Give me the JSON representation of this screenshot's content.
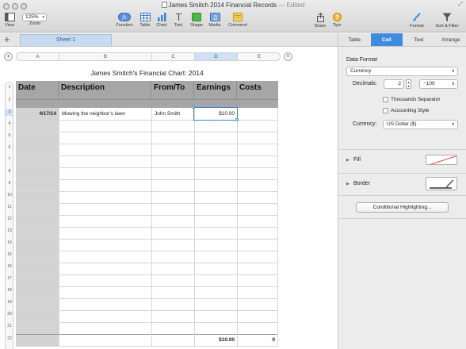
{
  "window": {
    "title": "James Smitch 2014 Financial Records",
    "status": "— Edited"
  },
  "toolbar": {
    "view": "View",
    "zoom_value": "125%",
    "zoom": "Zoom",
    "function": "Function",
    "table": "Table",
    "chart": "Chart",
    "text": "Text",
    "shape": "Shape",
    "media": "Media",
    "comment": "Comment",
    "share": "Share",
    "tips": "Tips",
    "format": "Format",
    "sort_filter": "Sort & Filter"
  },
  "sheets": {
    "add": "+",
    "active": "Sheet 1"
  },
  "columns": [
    "A",
    "B",
    "C",
    "D",
    "E"
  ],
  "table": {
    "title": "James Smitch's Financial Chart: 2014",
    "headers": [
      "Date",
      "Description",
      "From/To",
      "Earnings",
      "Costs"
    ],
    "row3": {
      "date": "4/17/14",
      "description": "Mowing the neighbor's lawn",
      "from_to": "John Smith",
      "earnings": "$10.00"
    },
    "row21": {
      "earnings": "$10.00",
      "costs": "0"
    },
    "row22": {
      "costs": "10"
    }
  },
  "row_numbers": [
    "1",
    "2",
    "3",
    "4",
    "5",
    "6",
    "7",
    "8",
    "9",
    "10",
    "11",
    "12",
    "13",
    "14",
    "15",
    "16",
    "17",
    "18",
    "19",
    "20",
    "21",
    "22"
  ],
  "inspector": {
    "tabs": [
      "Table",
      "Cell",
      "Text",
      "Arrange"
    ],
    "active_tab": "Cell",
    "data_format_label": "Data Format",
    "data_format_value": "Currency",
    "decimals_label": "Decimals:",
    "decimals_value": "2",
    "negative_value": "−100",
    "thousands_separator": "Thousands Separator",
    "accounting_style": "Accounting Style",
    "currency_label": "Currency:",
    "currency_value": "US Dollar ($)",
    "fill": "Fill",
    "border": "Border",
    "conditional_highlighting": "Conditional Highlighting..."
  },
  "colors": {
    "accent": "#3f8be0",
    "header_gray": "#a6a6a6",
    "selection": "#cfe0f5"
  }
}
